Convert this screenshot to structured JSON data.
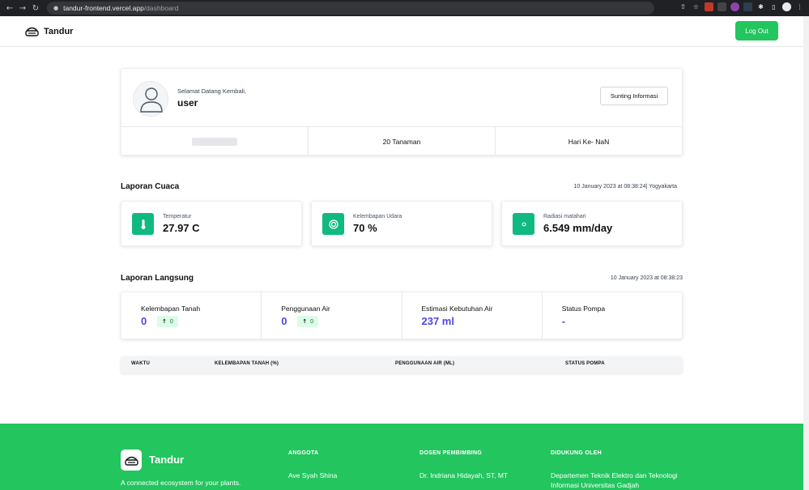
{
  "browser": {
    "url_host": "tandur-frontend.vercel.app",
    "url_path": "/dashboard"
  },
  "header": {
    "brand": "Tandur",
    "logout_label": "Log Out"
  },
  "profile": {
    "welcome": "Selamat Datang Kembali,",
    "username": "user",
    "edit_label": "Sunting Informasi",
    "plants": "20 Tanaman",
    "day": "Hari Ke- NaN"
  },
  "weather": {
    "title": "Laporan Cuaca",
    "timestamp": "10 January 2023 at 08:38:24| Yogyakarta",
    "cards": [
      {
        "label": "Temperatur",
        "value": "27.97 C",
        "icon": "thermometer-icon"
      },
      {
        "label": "Kelembapan Udara",
        "value": "70 %",
        "icon": "humidity-icon"
      },
      {
        "label": "Radiasi matahari",
        "value": "6.549 mm/day",
        "icon": "sun-icon"
      }
    ]
  },
  "live": {
    "title": "Laporan Langsung",
    "timestamp": "10 January 2023 at 08:38:23",
    "cells": [
      {
        "label": "Kelembapan Tanah",
        "value": "0",
        "trend": "0"
      },
      {
        "label": "Penggunaan Air",
        "value": "0",
        "trend": "0"
      },
      {
        "label": "Estimasi Kebutuhan Air",
        "value": "237 ml"
      },
      {
        "label": "Status Pompa",
        "value": "-"
      }
    ]
  },
  "table": {
    "columns": [
      "WAKTU",
      "KELEMBAPAN TANAH (%)",
      "PENGGUNAAN AIR (ML)",
      "STATUS POMPA"
    ]
  },
  "footer": {
    "brand": "Tandur",
    "tagline": "A connected ecosystem for your plants.",
    "members_title": "ANGGOTA",
    "member_1": "Ave Syah Shina",
    "advisor_title": "DOSEN PEMBIMBING",
    "advisor_1": "Dr. Indriana Hidayah, ST, MT",
    "supported_title": "DIDUKUNG OLEH",
    "supported_text": "Departemen Teknik Elektro dan Teknologi Informasi Universitas Gadjah"
  },
  "colors": {
    "brand_green": "#22c55e",
    "icon_green": "#10b981",
    "value_indigo": "#4f46e5"
  }
}
